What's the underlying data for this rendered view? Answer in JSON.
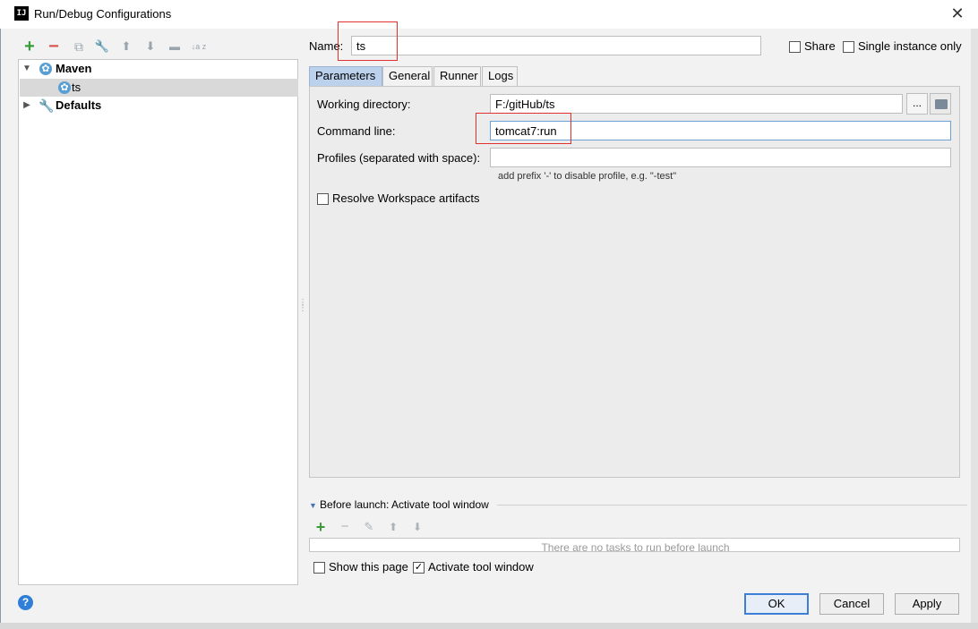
{
  "window": {
    "title": "Run/Debug Configurations",
    "app_icon_text": "IJ"
  },
  "toolbar": {
    "add": "+",
    "remove": "−",
    "copy": "⧉",
    "edit_defaults": "🔧",
    "move_up": "⬆",
    "move_down": "⬇",
    "folder": "▬",
    "sort": "↓a z"
  },
  "tree": {
    "items": [
      {
        "label": "Maven",
        "icon": "maven-gear-icon",
        "expanded": true,
        "bold": true
      },
      {
        "label": "ts",
        "icon": "maven-gear-icon",
        "selected": true
      },
      {
        "label": "Defaults",
        "icon": "wrench-icon",
        "expanded": false,
        "bold": true
      }
    ]
  },
  "form": {
    "name_label": "Name:",
    "name_value": "ts",
    "share_label": "Share",
    "single_instance_label": "Single instance only"
  },
  "tabs": [
    "Parameters",
    "General",
    "Runner",
    "Logs"
  ],
  "parameters": {
    "working_dir_label": "Working directory:",
    "working_dir_value": "F:/gitHub/ts",
    "browse_label": "...",
    "command_line_label": "Command line:",
    "command_line_value": "tomcat7:run",
    "profiles_label": "Profiles (separated with space):",
    "profiles_value": "",
    "profiles_hint": "add prefix '-' to disable profile, e.g. \"-test\"",
    "resolve_label": "Resolve Workspace artifacts"
  },
  "before_launch": {
    "header": "Before launch: Activate tool window",
    "empty_text": "There are no tasks to run before launch",
    "add": "+",
    "remove": "−",
    "edit": "✎",
    "up": "⬆",
    "down": "⬇"
  },
  "bottom": {
    "show_page_label": "Show this page",
    "activate_label": "Activate tool window",
    "help": "?",
    "ok": "OK",
    "cancel": "Cancel",
    "apply": "Apply"
  },
  "colors": {
    "accent": "#3c7fd5",
    "selected_tab": "#bcd1ec",
    "annotation_red": "#e03030"
  }
}
